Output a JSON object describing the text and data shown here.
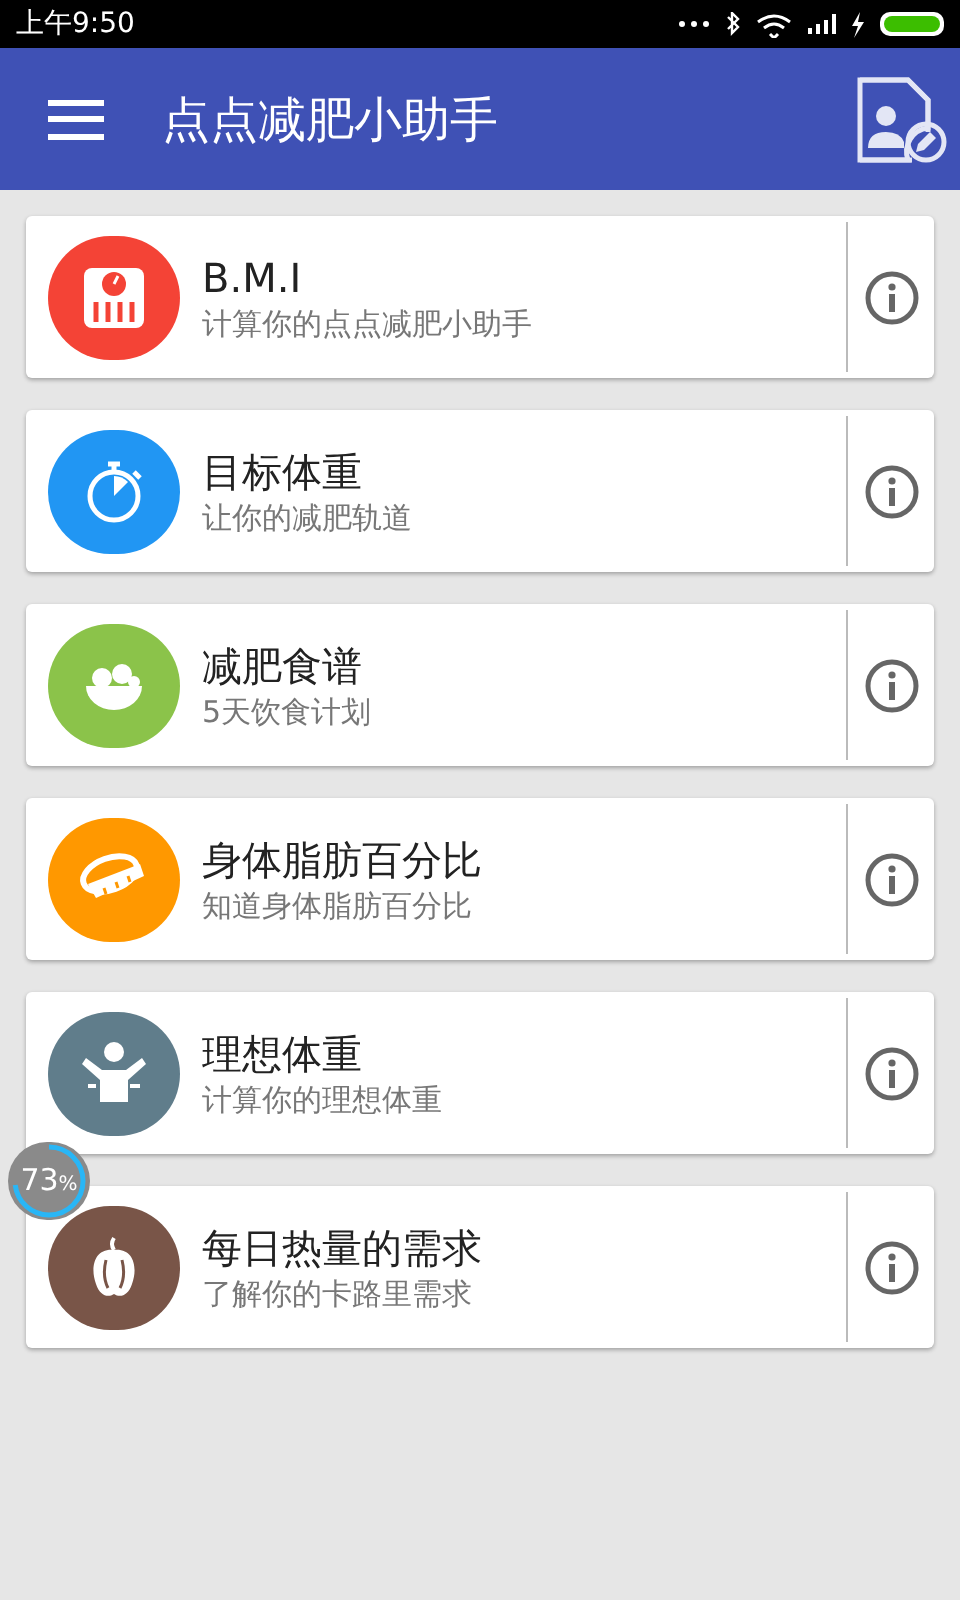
{
  "status_bar": {
    "time": "上午9:50"
  },
  "app_bar": {
    "title": "点点减肥小助手"
  },
  "items": [
    {
      "kind": "scale",
      "color": "#f44336",
      "title": "B.M.I",
      "subtitle": "计算你的点点减肥小助手"
    },
    {
      "kind": "stopwatch",
      "color": "#2196f3",
      "title": "目标体重",
      "subtitle": "让你的减肥轨道"
    },
    {
      "kind": "food",
      "color": "#8bc34a",
      "title": "减肥食谱",
      "subtitle": "5天饮食计划"
    },
    {
      "kind": "tape",
      "color": "#ff9800",
      "title": "身体脂肪百分比",
      "subtitle": "知道身体脂肪百分比"
    },
    {
      "kind": "person",
      "color": "#607d8b",
      "title": "理想体重",
      "subtitle": "计算你的理想体重"
    },
    {
      "kind": "pepper",
      "color": "#795548",
      "title": "每日热量的需求",
      "subtitle": "了解你的卡路里需求"
    }
  ],
  "memory_badge": {
    "value": "73",
    "unit": "%",
    "level": 0.73
  }
}
